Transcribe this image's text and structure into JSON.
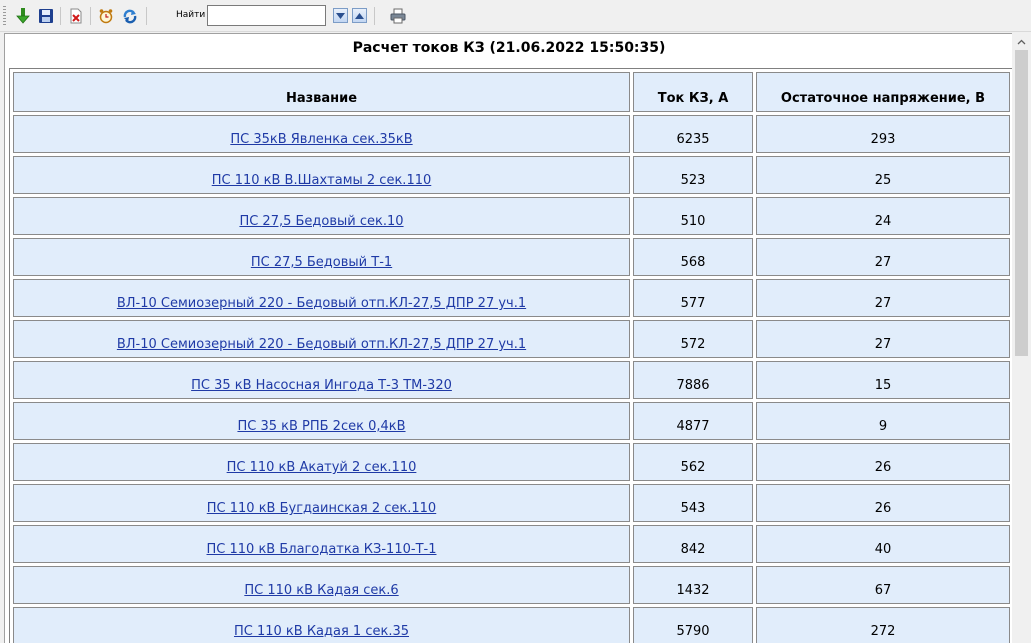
{
  "toolbar": {
    "find_label": "Найти",
    "find_value": "",
    "icons": [
      "export-green-arrow-icon",
      "save-floppy-icon",
      "delete-red-x-icon",
      "alarm-clock-icon",
      "refresh-icon",
      "find-next-icon",
      "find-prev-icon",
      "print-icon"
    ]
  },
  "report": {
    "title": "Расчет токов КЗ (21.06.2022 15:50:35)",
    "columns": [
      "Название",
      "Ток КЗ, А",
      "Остаточное напряжение, В"
    ],
    "rows": [
      {
        "name": "ПС 35кВ Явленка сек.35кВ",
        "current": "6235",
        "voltage": "293"
      },
      {
        "name": "ПС 110 кВ В.Шахтамы 2 сек.110",
        "current": "523",
        "voltage": "25"
      },
      {
        "name": "ПС 27,5 Бедовый сек.10",
        "current": "510",
        "voltage": "24"
      },
      {
        "name": "ПС 27,5 Бедовый Т-1",
        "current": "568",
        "voltage": "27"
      },
      {
        "name": "ВЛ-10 Семиозерный 220 - Бедовый отп.КЛ-27,5 ДПР 27 уч.1",
        "current": "577",
        "voltage": "27"
      },
      {
        "name": "ВЛ-10 Семиозерный 220 - Бедовый отп.КЛ-27,5 ДПР 27 уч.1",
        "current": "572",
        "voltage": "27"
      },
      {
        "name": "ПС 35 кВ Насосная Ингода Т-3 ТМ-320",
        "current": "7886",
        "voltage": "15"
      },
      {
        "name": "ПС 35 кВ РПБ 2сек 0,4кВ",
        "current": "4877",
        "voltage": "9"
      },
      {
        "name": "ПС 110 кВ Акатуй 2 сек.110",
        "current": "562",
        "voltage": "26"
      },
      {
        "name": "ПС 110 кВ Бугдаинская 2 сек.110",
        "current": "543",
        "voltage": "26"
      },
      {
        "name": "ПС 110 кВ Благодатка КЗ-110-Т-1",
        "current": "842",
        "voltage": "40"
      },
      {
        "name": "ПС 110 кВ Кадая сек.6",
        "current": "1432",
        "voltage": "67"
      },
      {
        "name": "ПС 110 кВ Кадая 1 сек.35",
        "current": "5790",
        "voltage": "272"
      }
    ]
  }
}
